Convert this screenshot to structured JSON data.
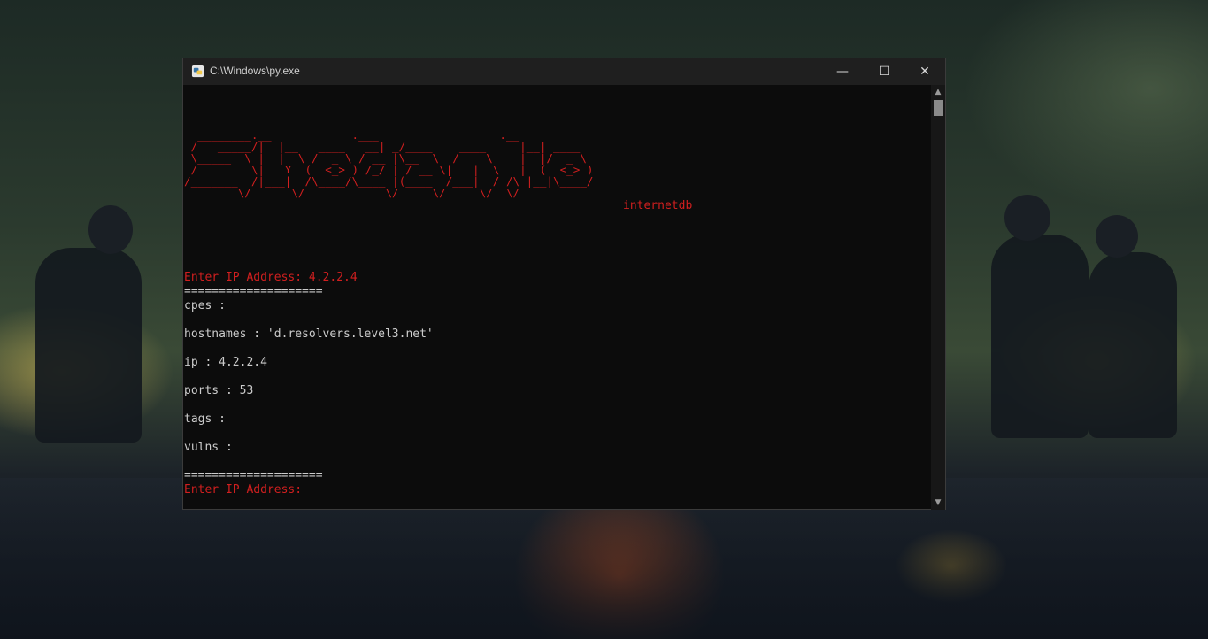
{
  "window": {
    "title": "C:\\Windows\\py.exe",
    "minimize_glyph": "—",
    "maximize_glyph": "☐",
    "close_glyph": "✕"
  },
  "console": {
    "banner_art": "  ________.__            .___                  .__        \n /   _____/|  |__   ____   __| _/____    ____     |__| ____  \n \\_____  \\ |  |  \\ /  _ \\ / __ |\\__  \\  /    \\    |  |/  _ \\ \n /        \\|   Y  (  <_> ) /_/ | / __ \\|   |  \\   |  (  <_> )\n/_______  /|___|  /\\____/\\____ |(____  /___|  / /\\ |__|\\____/ \n        \\/      \\/            \\/     \\/     \\/  \\/            ",
    "banner_tagline": "internetdb",
    "lines": [
      {
        "text": "Enter IP Address: 4.2.2.4",
        "color": "#d11f1f"
      },
      {
        "text": "====================",
        "color": "#cccccc"
      },
      {
        "text": "cpes :",
        "color": "#cccccc"
      },
      {
        "text": "",
        "color": "#cccccc"
      },
      {
        "text": "hostnames : 'd.resolvers.level3.net'",
        "color": "#cccccc"
      },
      {
        "text": "",
        "color": "#cccccc"
      },
      {
        "text": "ip : 4.2.2.4",
        "color": "#cccccc"
      },
      {
        "text": "",
        "color": "#cccccc"
      },
      {
        "text": "ports : 53",
        "color": "#cccccc"
      },
      {
        "text": "",
        "color": "#cccccc"
      },
      {
        "text": "tags :",
        "color": "#cccccc"
      },
      {
        "text": "",
        "color": "#cccccc"
      },
      {
        "text": "vulns :",
        "color": "#cccccc"
      },
      {
        "text": "",
        "color": "#cccccc"
      },
      {
        "text": "====================",
        "color": "#cccccc"
      },
      {
        "text": "Enter IP Address: ",
        "color": "#d11f1f"
      }
    ]
  },
  "colors": {
    "accent_red": "#d11f1f",
    "console_bg": "#0c0c0c",
    "titlebar_bg": "#1f1f1f"
  },
  "icons": {
    "app_icon": "python-launcher-icon",
    "scroll_up": "chevron-up-icon",
    "scroll_down": "chevron-down-icon"
  }
}
